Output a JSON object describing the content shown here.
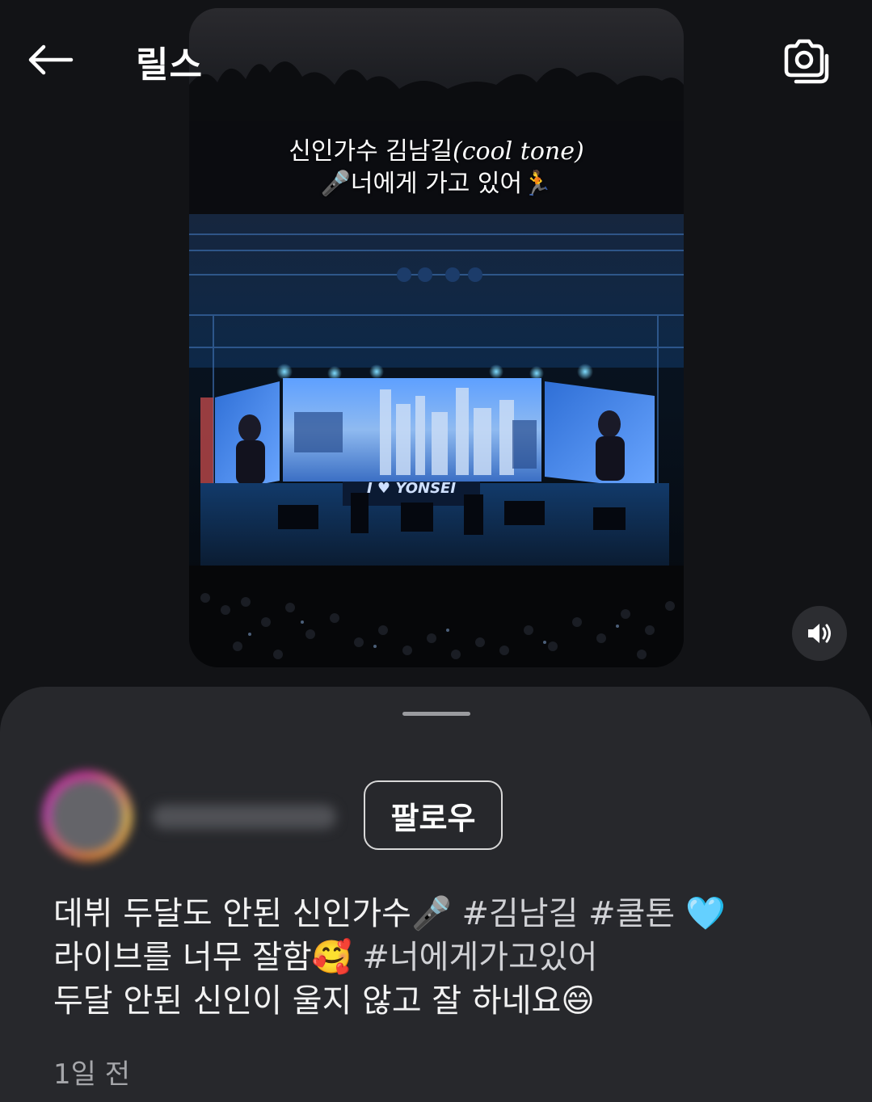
{
  "header": {
    "title": "릴스"
  },
  "video": {
    "overlay_line1_prefix": "신인가수 김남길",
    "overlay_line1_italic": "(cool tone)",
    "overlay_line2_mic": "🎤",
    "overlay_line2_text": "너에게 가고 있어",
    "overlay_line2_runner": "🏃",
    "banner_text": "I ♥ YONSEI"
  },
  "post": {
    "follow_label": "팔로우",
    "caption_line1_text": "데뷔 두달도 안된 신인가수🎤 ",
    "caption_line1_tag1": "#김남길",
    "caption_line1_tag2": "#쿨톤",
    "caption_line1_emoji": "🩵",
    "caption_line2_text": "라이브를 너무 잘함🥰 ",
    "caption_line2_tag": "#너에게가고있어",
    "caption_line3_text": "두달 안된 신인이 울지 않고 잘 하네요😄",
    "timestamp": "1일 전"
  },
  "icons": {
    "back": "arrow-left-icon",
    "camera": "camera-icon",
    "volume": "volume-icon"
  },
  "colors": {
    "background": "#121316",
    "sheet": "#27282c",
    "stage_blue": "#2e7cff"
  }
}
